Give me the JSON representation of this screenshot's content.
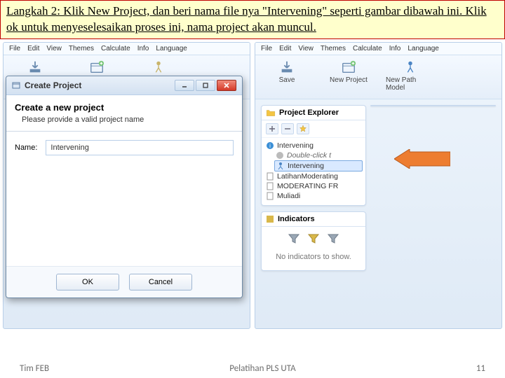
{
  "instruction_html": "<u>Langkah 2: Klik New Project, dan beri nama file nya \"Intervening\" seperti gambar dibawah ini. Klik ok untuk menyeselesaikan proses ini, nama project akan muncul.</u>",
  "menu": {
    "file": "File",
    "edit": "Edit",
    "view": "View",
    "themes": "Themes",
    "calculate": "Calculate",
    "info": "Info",
    "language": "Language"
  },
  "toolbar": {
    "save": "Save",
    "newproject": "New Project",
    "newpath": "New Path Model"
  },
  "explorer": {
    "title": "Project Explorer",
    "items": [
      {
        "label": "Intervening",
        "kind": "folder"
      },
      {
        "label": "Double-click t",
        "kind": "hint"
      },
      {
        "label": "Intervening",
        "kind": "model",
        "selected": true
      },
      {
        "label": "LatihanModerating",
        "kind": "file"
      },
      {
        "label": "MODERATING FR",
        "kind": "file"
      },
      {
        "label": "Muliadi",
        "kind": "file"
      }
    ]
  },
  "indicators": {
    "title": "Indicators",
    "message": "No indicators to show."
  },
  "dialog": {
    "window_title": "Create Project",
    "heading": "Create a new project",
    "subheading": "Please provide a valid project name",
    "name_label": "Name:",
    "name_value": "Intervening",
    "ok": "OK",
    "cancel": "Cancel"
  },
  "footer": {
    "left": "Tim FEB",
    "center": "Pelatihan PLS UTA",
    "page": "11"
  }
}
